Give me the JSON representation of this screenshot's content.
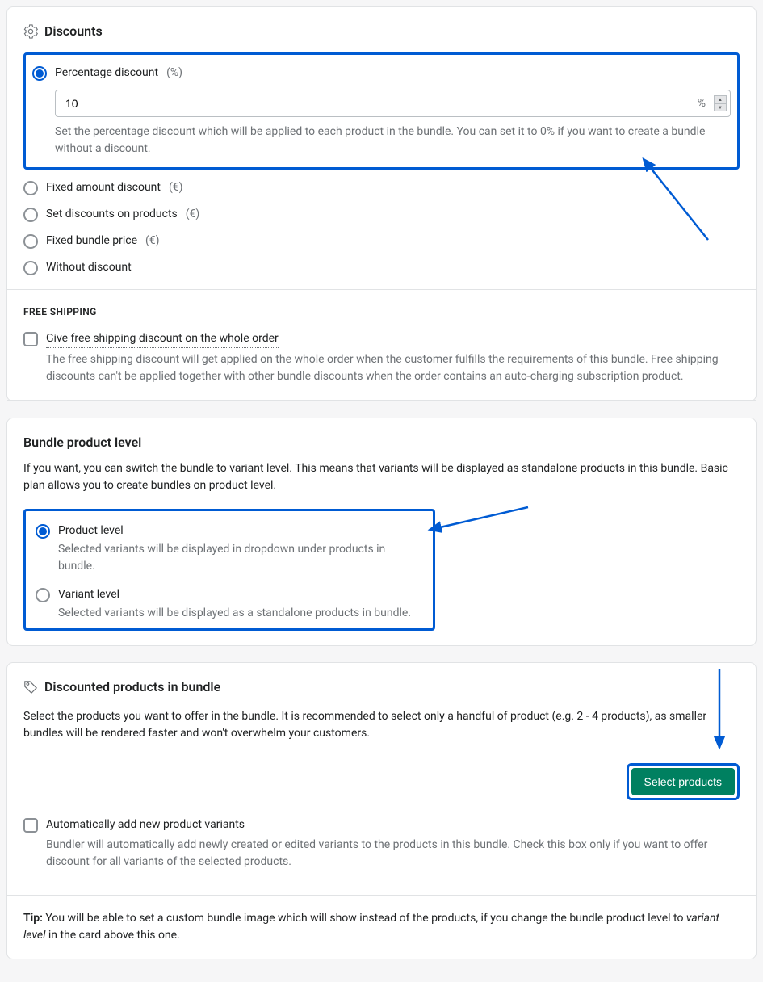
{
  "discounts": {
    "title": "Discounts",
    "percentage": {
      "label": "Percentage discount",
      "suffix": "(%)",
      "value": "10",
      "unit": "%",
      "help": "Set the percentage discount which will be applied to each product in the bundle. You can set it to 0% if you want to create a bundle without a discount."
    },
    "options": {
      "fixed_amount": {
        "label": "Fixed amount discount",
        "suffix": "(€)"
      },
      "set_on_products": {
        "label": "Set discounts on products",
        "suffix": "(€)"
      },
      "fixed_bundle_price": {
        "label": "Fixed bundle price",
        "suffix": "(€)"
      },
      "without": {
        "label": "Without discount"
      }
    }
  },
  "free_shipping": {
    "title": "FREE SHIPPING",
    "checkbox_label": "Give free shipping discount on the whole order",
    "help": "The free shipping discount will get applied on the whole order when the customer fulfills the requirements of this bundle. Free shipping discounts can't be applied together with other bundle discounts when the order contains an auto-charging subscription product."
  },
  "bundle_level": {
    "title": "Bundle product level",
    "intro": "If you want, you can switch the bundle to variant level. This means that variants will be displayed as standalone products in this bundle. Basic plan allows you to create bundles on product level.",
    "product": {
      "label": "Product level",
      "desc": "Selected variants will be displayed in dropdown under products in bundle."
    },
    "variant": {
      "label": "Variant level",
      "desc": "Selected variants will be displayed as a standalone products in bundle."
    }
  },
  "discounted_products": {
    "title": "Discounted products in bundle",
    "intro": "Select the products you want to offer in the bundle. It is recommended to select only a handful of product (e.g. 2 - 4 products), as smaller bundles will be rendered faster and won't overwhelm your customers.",
    "button": "Select products",
    "auto_add": {
      "label": "Automatically add new product variants",
      "help": "Bundler will automatically add newly created or edited variants to the products in this bundle. Check this box only if you want to offer discount for all variants of the selected products."
    },
    "tip_label": "Tip:",
    "tip_text": " You will be able to set a custom bundle image which will show instead of the products, if you change the bundle product level to ",
    "tip_italic": "variant level",
    "tip_tail": " in the card above this one."
  }
}
